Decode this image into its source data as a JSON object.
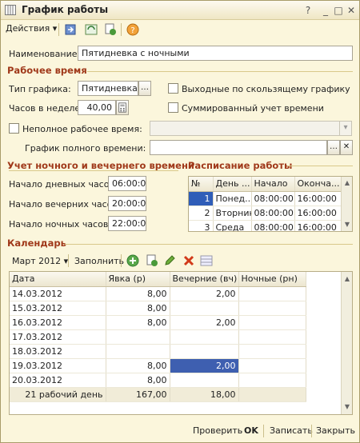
{
  "window": {
    "title": "График работы"
  },
  "toolbar": {
    "actions_label": "Действия"
  },
  "form": {
    "name_label": "Наименование:",
    "name_value": "Пятидневка с ночными",
    "work_time_section": "Рабочее время",
    "type_label": "Тип графика:",
    "type_value": "Пятидневка",
    "hours_label": "Часов в неделе:",
    "hours_value": "40,00",
    "weekend_sliding": "Выходные по скользящему графику",
    "summed_time": "Суммированный учет времени",
    "partial_time": "Неполное рабочее время:",
    "full_time_schedule": "График полного времени:",
    "night_section": "Учет ночного и вечернего времени",
    "day_start_label": "Начало дневных часов:",
    "day_start_value": "06:00:00",
    "evening_start_label": "Начало вечерних часов:",
    "evening_start_value": "20:00:00",
    "night_start_label": "Начало ночных часов:",
    "night_start_value": "22:00:00",
    "schedule_section": "Расписание работы",
    "calendar_section": "Календарь"
  },
  "schedule": {
    "columns": [
      "№",
      "День ...",
      "Начало",
      "Оконча..."
    ],
    "rows": [
      [
        "1",
        "Понед...",
        "08:00:00",
        "16:00:00"
      ],
      [
        "2",
        "Вторник",
        "08:00:00",
        "16:00:00"
      ],
      [
        "3",
        "Среда",
        "08:00:00",
        "16:00:00"
      ]
    ]
  },
  "calendar": {
    "month": "Март 2012",
    "fill_label": "Заполнить",
    "columns": [
      "Дата",
      "Явка (р)",
      "Вечерние (вч)",
      "Ночные (рн)"
    ],
    "rows": [
      [
        "14.03.2012",
        "8,00",
        "2,00",
        ""
      ],
      [
        "15.03.2012",
        "8,00",
        "",
        ""
      ],
      [
        "16.03.2012",
        "8,00",
        "2,00",
        ""
      ],
      [
        "17.03.2012",
        "",
        "",
        ""
      ],
      [
        "18.03.2012",
        "",
        "",
        ""
      ],
      [
        "19.03.2012",
        "8,00",
        "2,00",
        ""
      ],
      [
        "20.03.2012",
        "8,00",
        "",
        ""
      ]
    ],
    "footer": [
      "21 рабочий день",
      "167,00",
      "18,00",
      ""
    ]
  },
  "bottom": {
    "check": "Проверить",
    "ok": "OK",
    "save": "Записать",
    "close": "Закрыть"
  }
}
